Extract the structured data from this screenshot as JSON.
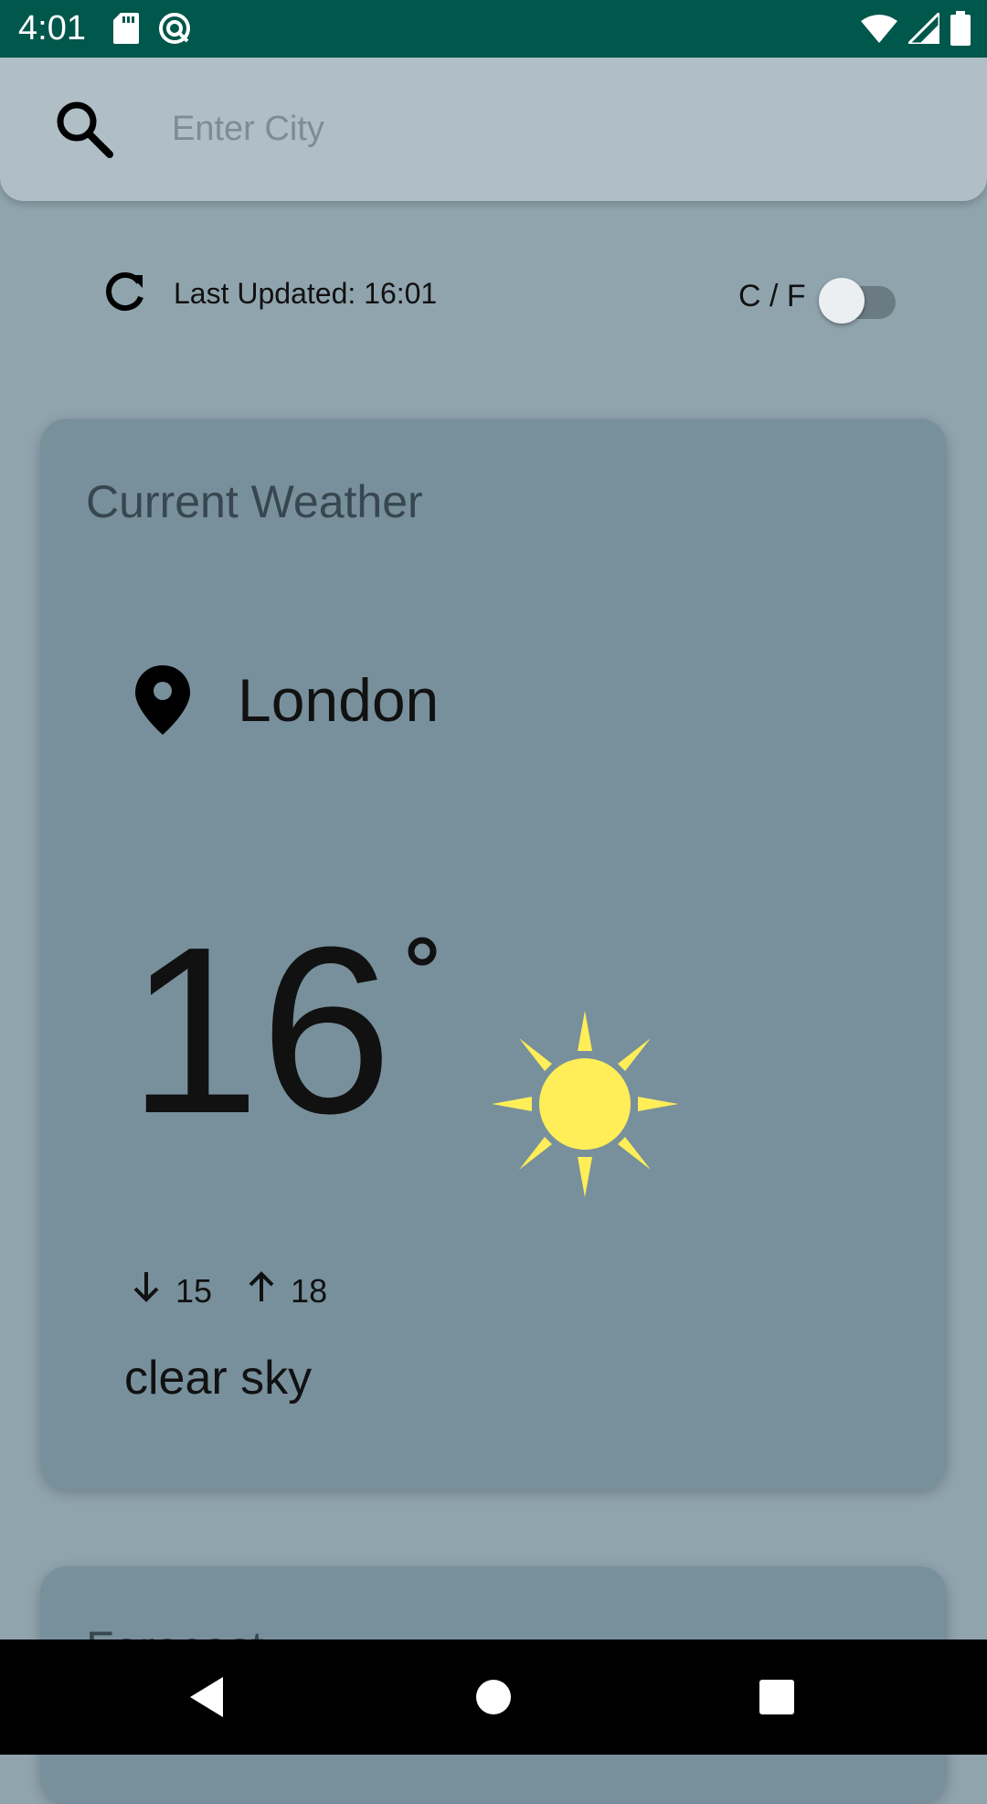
{
  "status_bar": {
    "time": "4:01",
    "icons": [
      "sd-card-icon",
      "sync-icon",
      "wifi-icon",
      "signal-icon",
      "battery-icon"
    ]
  },
  "search": {
    "placeholder": "Enter City",
    "value": ""
  },
  "update_row": {
    "last_updated": "Last Updated: 16:01"
  },
  "unit_toggle": {
    "label": "C / F",
    "checked": false
  },
  "current_weather": {
    "title": "Current Weather",
    "city": "London",
    "temperature": "16",
    "condition_icon": "sun-icon",
    "min": "15",
    "max": "18",
    "description": "clear sky"
  },
  "forecast": {
    "title": "Forecast"
  },
  "colors": {
    "status_bar": "#00574b",
    "background": "#90a4ae",
    "card": "#78909c",
    "search_bar": "#b0bec5",
    "sun": "#ffee58"
  }
}
